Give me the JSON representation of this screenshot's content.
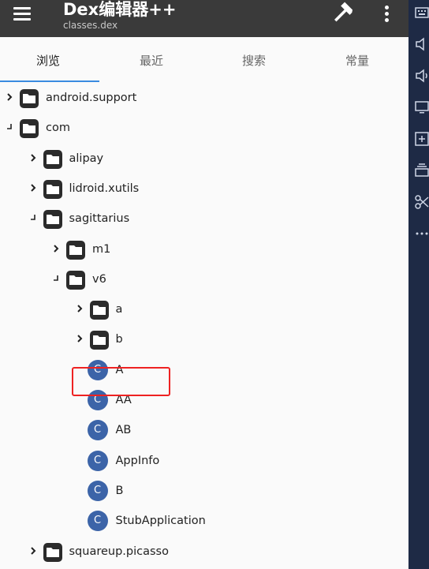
{
  "app": {
    "title": "Dex编辑器++",
    "subtitle": "classes.dex",
    "icons": {
      "menu": "menu-icon",
      "build": "hammer-icon",
      "more": "more-vertical-icon"
    },
    "colors": {
      "appbar": "#3a3a3a",
      "indicator": "#3a8be0",
      "class_badge": "#3c64a8",
      "highlight": "#e22222"
    }
  },
  "tabs": [
    {
      "label": "浏览",
      "active": true
    },
    {
      "label": "最近",
      "active": false
    },
    {
      "label": "搜索",
      "active": false
    },
    {
      "label": "常量",
      "active": false
    }
  ],
  "tree": [
    {
      "label": "android.support",
      "type": "folder",
      "depth": 0,
      "expanded": false
    },
    {
      "label": "com",
      "type": "folder",
      "depth": 0,
      "expanded": true
    },
    {
      "label": "alipay",
      "type": "folder",
      "depth": 1,
      "expanded": false
    },
    {
      "label": "lidroid.xutils",
      "type": "folder",
      "depth": 1,
      "expanded": false
    },
    {
      "label": "sagittarius",
      "type": "folder",
      "depth": 1,
      "expanded": true
    },
    {
      "label": "m1",
      "type": "folder",
      "depth": 2,
      "expanded": false
    },
    {
      "label": "v6",
      "type": "folder",
      "depth": 2,
      "expanded": true
    },
    {
      "label": "a",
      "type": "folder",
      "depth": 3,
      "expanded": false
    },
    {
      "label": "b",
      "type": "folder",
      "depth": 3,
      "expanded": false
    },
    {
      "label": "A",
      "type": "class",
      "depth": 3
    },
    {
      "label": "AA",
      "type": "class",
      "depth": 3
    },
    {
      "label": "AB",
      "type": "class",
      "depth": 3
    },
    {
      "label": "AppInfo",
      "type": "class",
      "depth": 3,
      "highlighted": true
    },
    {
      "label": "B",
      "type": "class",
      "depth": 3
    },
    {
      "label": "StubApplication",
      "type": "class",
      "depth": 3
    },
    {
      "label": "squareup.picasso",
      "type": "folder",
      "depth": 1,
      "expanded": false
    }
  ],
  "class_badge_letter": "C",
  "side_toolbar": [
    "keyboard-icon",
    "volume-down-icon",
    "volume-up-icon",
    "screen-icon",
    "add-app-icon",
    "layers-icon",
    "scissors-icon",
    "more-horizontal-icon"
  ]
}
